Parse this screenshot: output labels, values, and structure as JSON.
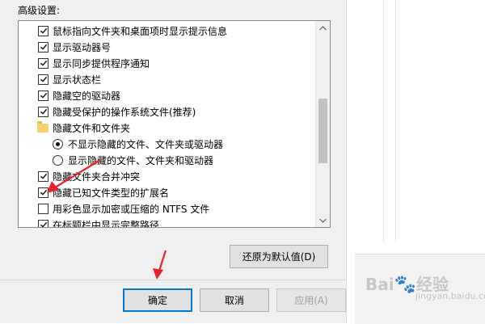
{
  "advanced_settings": {
    "label": "高级设置:",
    "items": [
      {
        "type": "checkbox",
        "label": "鼠标指向文件夹和桌面项时显示提示信息",
        "checked": true
      },
      {
        "type": "checkbox",
        "label": "显示驱动器号",
        "checked": true
      },
      {
        "type": "checkbox",
        "label": "显示同步提供程序通知",
        "checked": true
      },
      {
        "type": "checkbox",
        "label": "显示状态栏",
        "checked": true
      },
      {
        "type": "checkbox",
        "label": "隐藏空的驱动器",
        "checked": true
      },
      {
        "type": "checkbox",
        "label": "隐藏受保护的操作系统文件(推荐)",
        "checked": true
      },
      {
        "type": "folder",
        "label": "隐藏文件和文件夹"
      },
      {
        "type": "radio",
        "label": "不显示隐藏的文件、文件夹或驱动器",
        "selected": true
      },
      {
        "type": "radio",
        "label": "显示隐藏的文件、文件夹和驱动器",
        "selected": false
      },
      {
        "type": "checkbox",
        "label": "隐藏文件夹合并冲突",
        "checked": true
      },
      {
        "type": "checkbox",
        "label": "隐藏已知文件类型的扩展名",
        "checked": true
      },
      {
        "type": "checkbox",
        "label": "用彩色显示加密或压缩的 NTFS 文件",
        "checked": false
      },
      {
        "type": "checkbox",
        "label": "在标题栏中显示完整路径",
        "checked": true
      }
    ]
  },
  "buttons": {
    "restore_defaults": "还原为默认值(D)",
    "ok": "确定",
    "cancel": "取消",
    "apply": "应用(A)"
  },
  "watermark": {
    "brand": "Bai",
    "brand2": "经验",
    "sub": "jingyan.baidu.com"
  },
  "colors": {
    "annotation_arrow": "#e8222a",
    "dialog_bg": "#f0f0f0",
    "focus_blue": "#0078d7"
  }
}
